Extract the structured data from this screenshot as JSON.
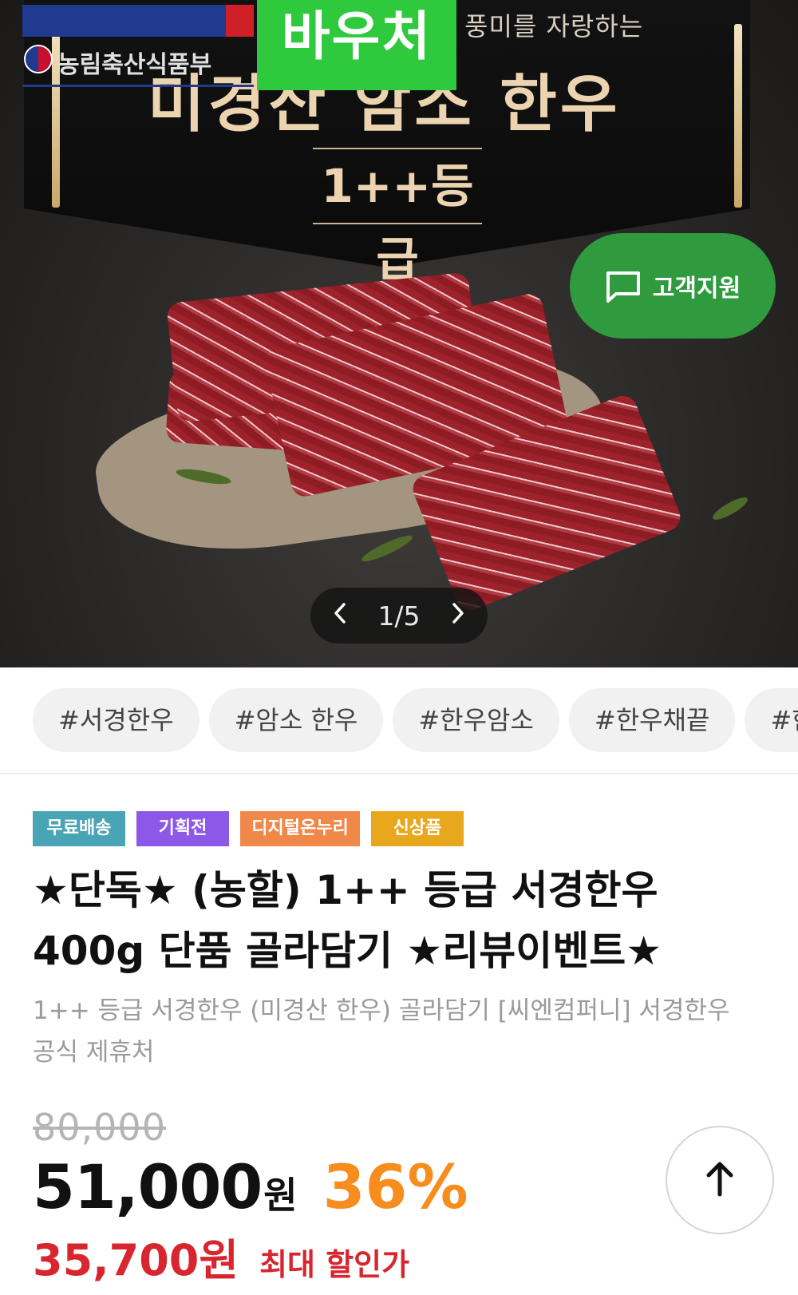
{
  "hero": {
    "gov_name": "농림축산식품부",
    "voucher": "바우처",
    "subtitle": "풍미를 자랑하는",
    "title": "미경산 암소 한우",
    "grade": "1++등급",
    "support_label": "고객지원",
    "pager": {
      "current_total": "1/5",
      "prev": "‹",
      "next": "›"
    }
  },
  "tags": [
    "#서경한우",
    "#암소 한우",
    "#한우암소",
    "#한우채끝",
    "#한우"
  ],
  "badges": [
    "무료배송",
    "기획전",
    "디지털온누리",
    "신상품"
  ],
  "product": {
    "title": "★단독★ (농할) 1++ 등급 서경한우 400g 단품 골라담기 ★리뷰이벤트★",
    "subtitle": "1++ 등급 서경한우 (미경산 한우) 골라담기 [씨엔컴퍼니] 서경한우 공식 제휴처"
  },
  "price": {
    "original": "80,000",
    "sale": "51,000",
    "currency": "원",
    "discount": "36%",
    "max_price": "35,700원",
    "max_label": "최대 할인가"
  },
  "colors": {
    "support_green": "#2f9a3e",
    "voucher_green": "#2ec93c",
    "discount_orange": "#f78d1e",
    "max_red": "#d8262f"
  },
  "icons": [
    "chat-icon",
    "chevron-left-icon",
    "chevron-right-icon",
    "arrow-up-icon",
    "gov-emblem-icon"
  ]
}
